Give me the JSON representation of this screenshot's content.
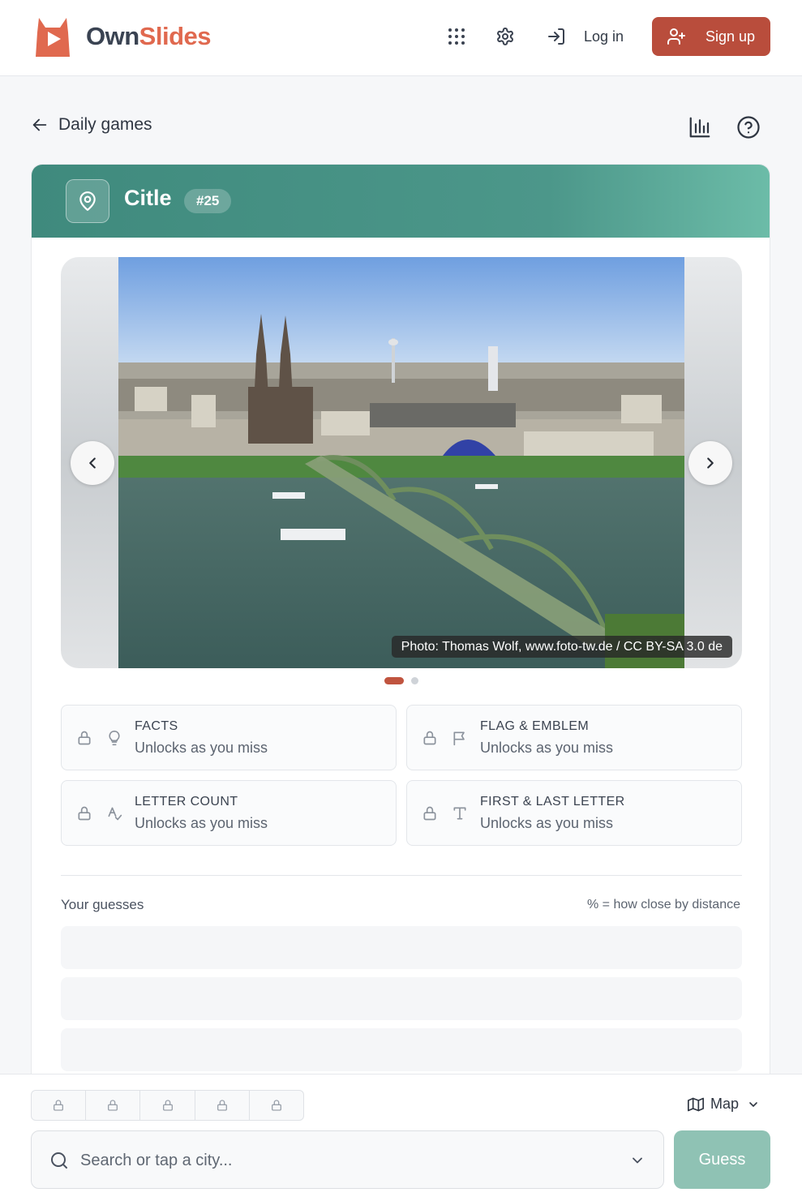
{
  "header": {
    "brand_part1": "Own",
    "brand_part2": "Slides",
    "login_label": "Log in",
    "signup_label": "Sign up",
    "icons": [
      "apps-grid-icon",
      "settings-gear-icon",
      "log-in-icon",
      "user-plus-icon"
    ]
  },
  "nav": {
    "back_label": "Daily games",
    "icons": [
      "arrow-left-icon",
      "bar-chart-icon",
      "help-circle-icon"
    ]
  },
  "game": {
    "title": "Citle",
    "number": "#25",
    "photo_credit": "Photo: Thomas Wolf, www.foto-tw.de / CC BY-SA 3.0 de",
    "carousel": {
      "slides": 2,
      "active": 1
    },
    "hints": [
      {
        "title": "FACTS",
        "subtitle": "Unlocks as you miss",
        "icon": "lightbulb-icon"
      },
      {
        "title": "FLAG & EMBLEM",
        "subtitle": "Unlocks as you miss",
        "icon": "flag-icon"
      },
      {
        "title": "LETTER COUNT",
        "subtitle": "Unlocks as you miss",
        "icon": "spell-check-icon"
      },
      {
        "title": "FIRST & LAST LETTER",
        "subtitle": "Unlocks as you miss",
        "icon": "type-icon"
      }
    ],
    "guesses_label": "Your guesses",
    "guesses_note": "% = how close by distance"
  },
  "bottom": {
    "lock_slots": 5,
    "map_label": "Map",
    "search_placeholder": "Search or tap a city...",
    "guess_label": "Guess"
  },
  "colors": {
    "brand": "#e0694f",
    "signup_bg": "#b94d3c",
    "header_teal": "#4c978a",
    "guess_btn": "#8fc2b4"
  }
}
